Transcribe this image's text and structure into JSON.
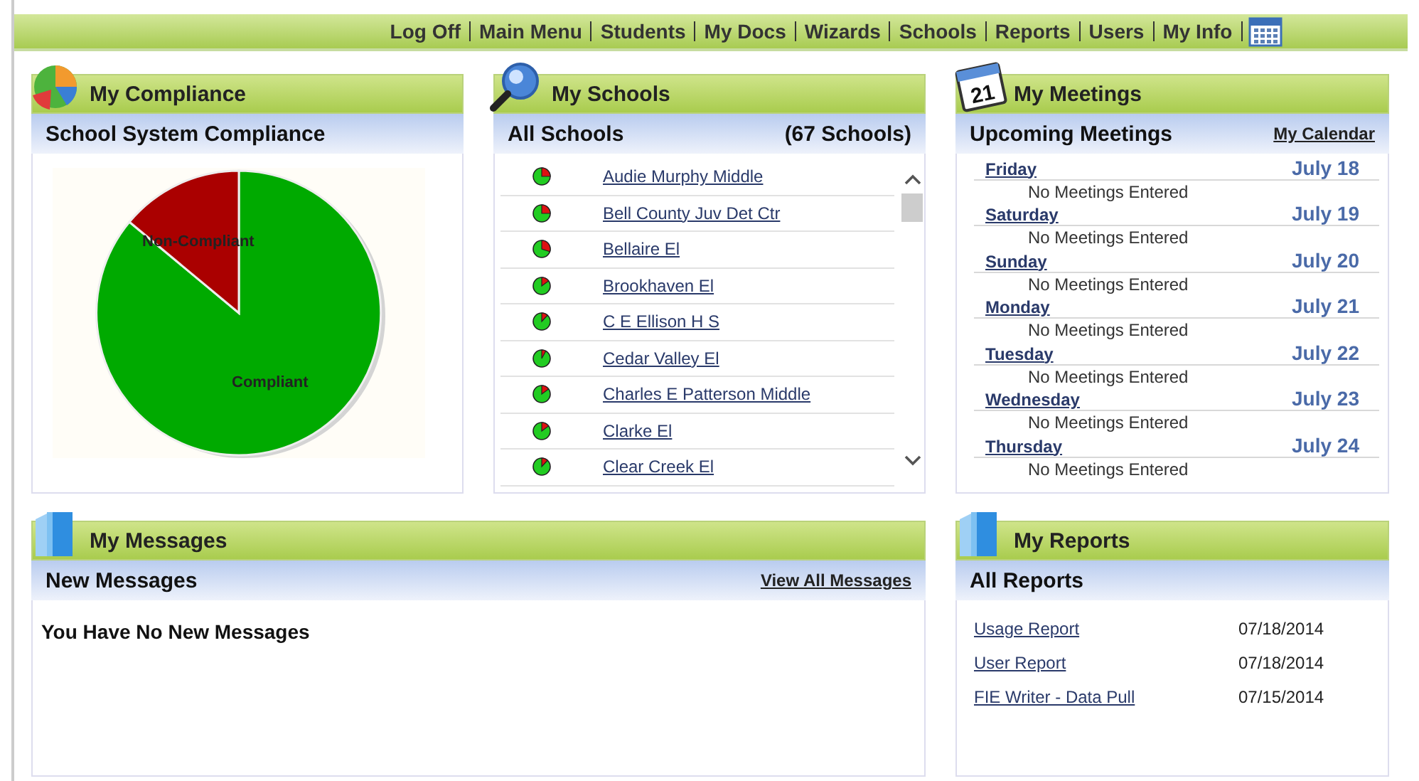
{
  "nav": {
    "items": [
      "Log Off",
      "Main Menu",
      "Students",
      "My Docs",
      "Wizards",
      "Schools",
      "Reports",
      "Users",
      "My Info"
    ]
  },
  "compliance": {
    "title": "My Compliance",
    "subtitle": "School System Compliance",
    "chart_labels": [
      "Non-Compliant",
      "Compliant"
    ]
  },
  "schools": {
    "title": "My Schools",
    "subtitle": "All Schools",
    "count": "(67 Schools)",
    "items": [
      {
        "name": "Audie Murphy Middle"
      },
      {
        "name": "Bell County Juv Det Ctr"
      },
      {
        "name": "Bellaire El"
      },
      {
        "name": "Brookhaven El"
      },
      {
        "name": "C E Ellison H S"
      },
      {
        "name": "Cedar Valley El"
      },
      {
        "name": "Charles E Patterson Middle"
      },
      {
        "name": "Clarke El"
      },
      {
        "name": "Clear Creek El"
      }
    ]
  },
  "meetings": {
    "title": "My Meetings",
    "icon_day": "21",
    "subtitle": "Upcoming Meetings",
    "link": "My Calendar",
    "days": [
      {
        "day": "Friday",
        "date": "July 18",
        "note": "No Meetings Entered"
      },
      {
        "day": "Saturday",
        "date": "July 19",
        "note": "No Meetings Entered"
      },
      {
        "day": "Sunday",
        "date": "July 20",
        "note": "No Meetings Entered"
      },
      {
        "day": "Monday",
        "date": "July 21",
        "note": "No Meetings Entered"
      },
      {
        "day": "Tuesday",
        "date": "July 22",
        "note": "No Meetings Entered"
      },
      {
        "day": "Wednesday",
        "date": "July 23",
        "note": "No Meetings Entered"
      },
      {
        "day": "Thursday",
        "date": "July 24",
        "note": "No Meetings Entered"
      }
    ]
  },
  "messages": {
    "title": "My Messages",
    "subtitle": "New Messages",
    "link": "View All Messages",
    "empty_text": "You Have No New Messages"
  },
  "reports": {
    "title": "My Reports",
    "subtitle": "All Reports",
    "items": [
      {
        "name": "Usage Report",
        "date": "07/18/2014"
      },
      {
        "name": "User Report",
        "date": "07/18/2014"
      },
      {
        "name": "FIE Writer - Data Pull",
        "date": "07/15/2014"
      }
    ]
  }
}
